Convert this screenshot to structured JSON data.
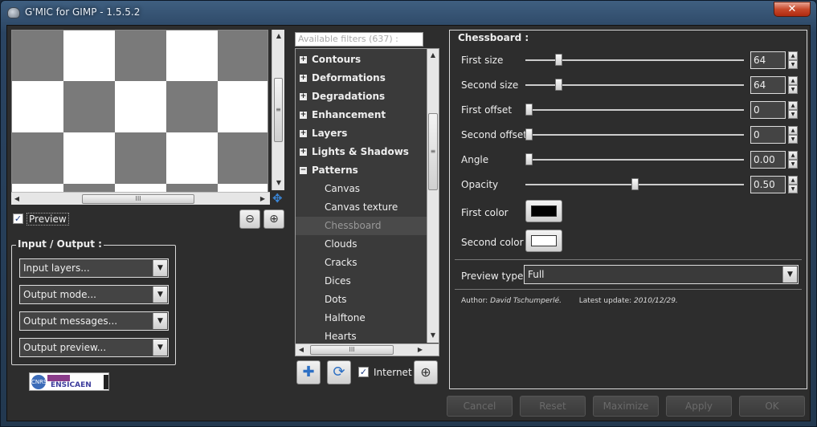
{
  "window": {
    "title": "G'MIC for GIMP - 1.5.5.2",
    "close_glyph": "✕"
  },
  "colors": {
    "chess_dark": "#7a7a7a",
    "chess_light": "#ffffff",
    "first_color": "#000000",
    "second_color": "#ffffff",
    "panel_bg": "#2d2d2d"
  },
  "preview": {
    "checkbox_label": "Preview",
    "checked": true,
    "scroll_glyph": "III",
    "zoom_out_icon": "zoom-out-icon",
    "zoom_in_icon": "zoom-in-icon"
  },
  "io": {
    "title": "Input / Output :",
    "combos": [
      "Input layers...",
      "Output mode...",
      "Output messages...",
      "Output preview..."
    ]
  },
  "logo": {
    "cnrs": "CNRS",
    "ensicaen": "ENSICAEN"
  },
  "filters": {
    "search_placeholder": "Available filters (637) :",
    "categories": [
      {
        "label": "Contours",
        "expander": "+"
      },
      {
        "label": "Deformations",
        "expander": "+"
      },
      {
        "label": "Degradations",
        "expander": "+"
      },
      {
        "label": "Enhancement",
        "expander": "+"
      },
      {
        "label": "Layers",
        "expander": "+"
      },
      {
        "label": "Lights & Shadows",
        "expander": "+"
      },
      {
        "label": "Patterns",
        "expander": "−"
      }
    ],
    "items": [
      "Canvas",
      "Canvas texture",
      "Chessboard",
      "Clouds",
      "Cracks",
      "Dices",
      "Dots",
      "Halftone",
      "Hearts"
    ],
    "selected": "Chessboard",
    "internet_label": "Internet",
    "internet_checked": true
  },
  "params": {
    "title": "Chessboard :",
    "rows": [
      {
        "label": "First size",
        "value": "64",
        "level": 0.14
      },
      {
        "label": "Second size",
        "value": "64",
        "level": 0.14
      },
      {
        "label": "First offset",
        "value": "0",
        "level": 0.0
      },
      {
        "label": "Second offset",
        "value": "0",
        "level": 0.0
      },
      {
        "label": "Angle",
        "value": "0.00",
        "level": 0.0
      },
      {
        "label": "Opacity",
        "value": "0.50",
        "level": 0.5
      }
    ],
    "first_color_label": "First color",
    "second_color_label": "Second color",
    "preview_type_label": "Preview type",
    "preview_type_value": "Full",
    "author_label": "Author:",
    "author_name": "David Tschumperlé.",
    "update_label": "Latest update:",
    "update_date": "2010/12/29."
  },
  "actions": {
    "cancel": "Cancel",
    "reset": "Reset",
    "maximize": "Maximize",
    "apply": "Apply",
    "ok": "OK"
  }
}
